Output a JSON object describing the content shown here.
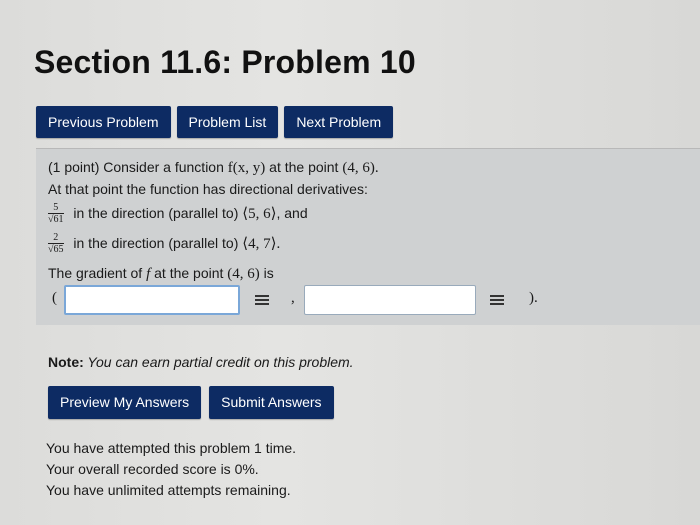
{
  "title": "Section 11.6: Problem 10",
  "nav": {
    "previous": "Previous Problem",
    "list": "Problem List",
    "next": "Next Problem"
  },
  "problem": {
    "line1_prefix": "(1 point) Consider a function ",
    "fn": "f(x, y)",
    "line1_mid": " at the point ",
    "point": "(4, 6).",
    "line2": "At that point the function has directional derivatives:",
    "d1_num": "5",
    "d1_den": "√61",
    "d1_text": " in the direction (parallel to) ",
    "d1_vec": "⟨5, 6⟩",
    "d1_suffix": ", and",
    "d2_num": "2",
    "d2_den": "√65",
    "d2_text": " in the direction (parallel to) ",
    "d2_vec": "⟨4, 7⟩.",
    "grad_prefix": "The gradient of ",
    "grad_fn": "f",
    "grad_mid": " at the point ",
    "grad_point": "(4, 6)",
    "grad_suffix": " is",
    "open_paren": "(",
    "comma": ",",
    "close_paren": ")."
  },
  "answers": [
    {
      "value": "",
      "placeholder": ""
    },
    {
      "value": "",
      "placeholder": ""
    }
  ],
  "note": {
    "label": "Note:",
    "text": " You can earn partial credit on this problem."
  },
  "actions": {
    "preview": "Preview My Answers",
    "submit": "Submit Answers"
  },
  "status": {
    "attempts": "You have attempted this problem 1 time.",
    "score": "Your overall recorded score is 0%.",
    "remaining": "You have unlimited attempts remaining."
  },
  "colors": {
    "button": "#0d2b63",
    "panel": "#cfd1d2",
    "focus": "#7aa7d8"
  }
}
